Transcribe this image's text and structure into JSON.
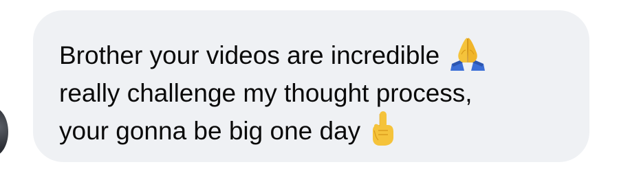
{
  "message": {
    "lines": [
      "Brother your videos are incredible",
      "really challenge my thought process,",
      "your gonna be big one day"
    ],
    "emojis": [
      "folded-hands-emoji",
      "index-pointing-up-emoji"
    ]
  },
  "colors": {
    "bubble_background": "#eff1f4",
    "text": "#0a0a0a"
  }
}
